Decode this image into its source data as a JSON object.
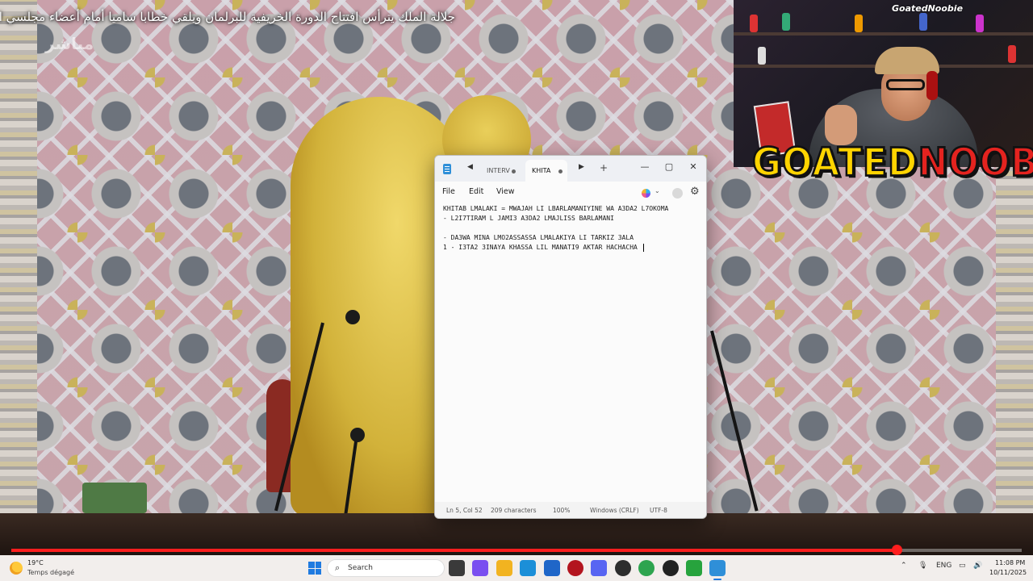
{
  "video": {
    "caption": "جلالة الملك يترأس افتتاح الدورة الخريفية للبرلمان ويلقي خطابا ساميا أمام أعضاء مجلسي البرلمان",
    "live_label": "مباشر",
    "progress_fraction": 0.876
  },
  "webcam": {
    "handle": "GoatedNoobie",
    "logo_part1": "GOATED",
    "logo_part2": "NOOBIE"
  },
  "notepad": {
    "tabs": [
      {
        "label": "INTERV",
        "active": false,
        "unsaved": true
      },
      {
        "label": "KHITA",
        "active": true,
        "unsaved": true
      }
    ],
    "new_tab_label": "+",
    "window_controls": {
      "minimize": "—",
      "maximize": "▢",
      "close": "✕"
    },
    "menu": {
      "file": "File",
      "edit": "Edit",
      "view": "View"
    },
    "lines": [
      "KHITAB LMALAKI = MWAJAH LI LBARLAMANIYINE WA A3DA2 L7OKOMA",
      "- L2I7TIRAM L JAMI3 A3DA2 LMAJLISS BARLAMANI",
      "",
      "- DA3WA MINA LMO2ASSASSA LMALAKIYA LI TARKIZ 3ALA",
      "1 - I3TA2 3INAYA KHASSA LIL MANATI9 AKTAR HACHACHA "
    ],
    "status": {
      "position": "Ln 5, Col 52",
      "characters": "209 characters",
      "zoom": "100%",
      "line_ending": "Windows (CRLF)",
      "encoding": "UTF-8"
    }
  },
  "taskbar": {
    "weather_temp": "19°C",
    "weather_desc": "Temps dégagé",
    "search_placeholder": "Search",
    "language": "ENG",
    "time": "11:08 PM",
    "date": "10/11/2025",
    "apps": [
      {
        "name": "task-view",
        "color": "#3a3a3a"
      },
      {
        "name": "copilot",
        "color": "#7a4ff0"
      },
      {
        "name": "file-explorer",
        "color": "#f2b320"
      },
      {
        "name": "edge",
        "color": "#1c8fd8"
      },
      {
        "name": "store",
        "color": "#1f66c8"
      },
      {
        "name": "recorder",
        "color": "#b3141e"
      },
      {
        "name": "discord",
        "color": "#5865f2"
      },
      {
        "name": "obs",
        "color": "#2d2d2d"
      },
      {
        "name": "chrome",
        "color": "#2ea44f"
      },
      {
        "name": "github",
        "color": "#222222"
      },
      {
        "name": "terminal",
        "color": "#27a33d"
      },
      {
        "name": "notepad",
        "color": "#2f8fd8"
      }
    ]
  }
}
